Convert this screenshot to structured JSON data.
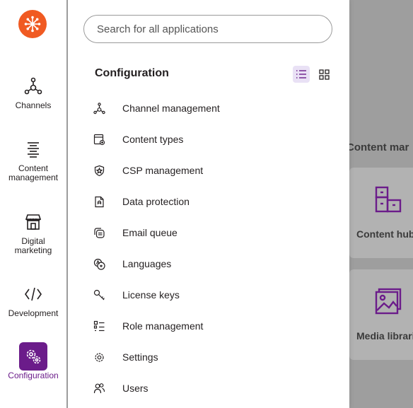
{
  "brand": {
    "accent": "#6b1c8a",
    "logo_color": "#f05a22"
  },
  "rail": {
    "items": [
      {
        "label": "Channels",
        "icon": "channels-icon"
      },
      {
        "label": "Content\nmanagement",
        "icon": "content-management-icon"
      },
      {
        "label": "Digital\nmarketing",
        "icon": "digital-marketing-icon"
      },
      {
        "label": "Development",
        "icon": "development-icon"
      },
      {
        "label": "Configuration",
        "icon": "configuration-icon",
        "active": true
      }
    ]
  },
  "search": {
    "placeholder": "Search for all applications",
    "value": ""
  },
  "panel": {
    "title": "Configuration",
    "view_mode": "list",
    "items": [
      {
        "label": "Channel management",
        "icon": "channel-management-icon"
      },
      {
        "label": "Content types",
        "icon": "content-types-icon"
      },
      {
        "label": "CSP management",
        "icon": "csp-shield-icon"
      },
      {
        "label": "Data protection",
        "icon": "data-protection-icon"
      },
      {
        "label": "Email queue",
        "icon": "email-queue-icon"
      },
      {
        "label": "Languages",
        "icon": "languages-icon"
      },
      {
        "label": "License keys",
        "icon": "license-key-icon"
      },
      {
        "label": "Role management",
        "icon": "role-management-icon"
      },
      {
        "label": "Settings",
        "icon": "settings-icon"
      },
      {
        "label": "Users",
        "icon": "users-icon"
      }
    ]
  },
  "background": {
    "heading": "Content mar",
    "cards": [
      {
        "label": "Content hub",
        "icon": "content-hub-icon"
      },
      {
        "label": "Media librarie",
        "icon": "media-library-icon"
      }
    ]
  }
}
